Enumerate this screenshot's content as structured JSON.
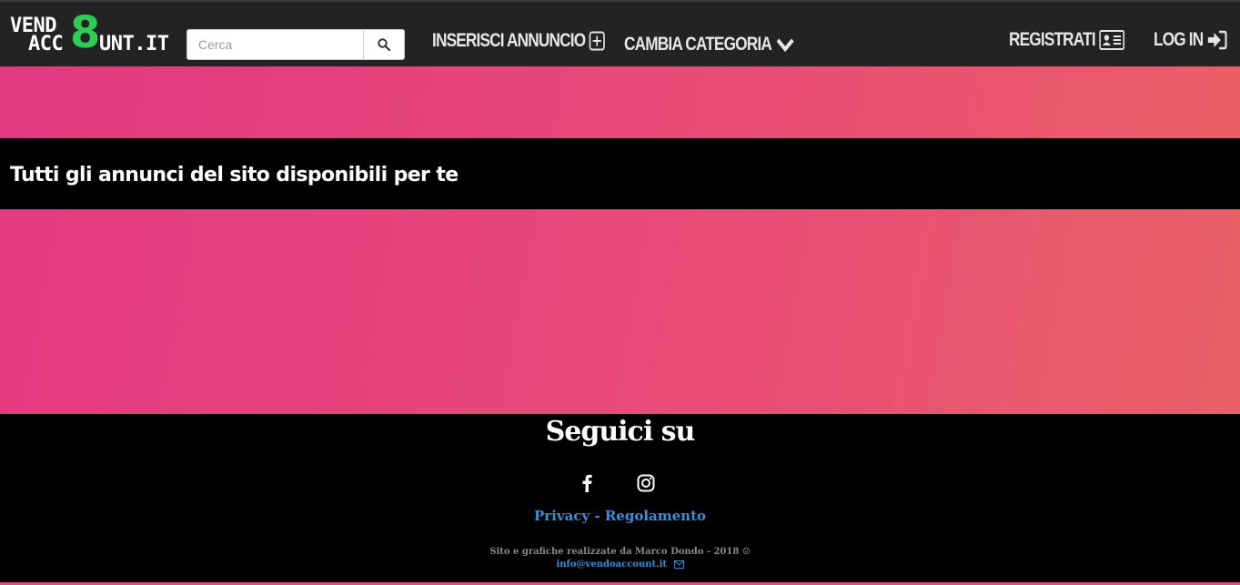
{
  "logo": {
    "line1": "VEND",
    "eight": "8",
    "line2a": "ACC",
    "line2b": "UNT.IT"
  },
  "search": {
    "placeholder": "Cerca",
    "icon": "search-icon"
  },
  "nav": {
    "insert": "INSERISCI ANNUNCIO",
    "category": "CAMBIA CATEGORIA",
    "register": "REGISTRATI",
    "login": "LOG IN"
  },
  "main": {
    "title": "Tutti gli annunci del sito disponibili per te"
  },
  "footer": {
    "follow": "Seguici su",
    "social": [
      "facebook-icon",
      "instagram-icon"
    ],
    "privacy": "Privacy",
    "separator": "-",
    "rules": "Regolamento",
    "credit": "Sito e grafiche realizzate da Marco Dondo - 2018 ☺",
    "email": "info@vendoaccount.it"
  },
  "colors": {
    "accent": "#e8487a",
    "logo_green": "#2ecc55",
    "link": "#3a8fd8",
    "navbar": "#232323"
  }
}
